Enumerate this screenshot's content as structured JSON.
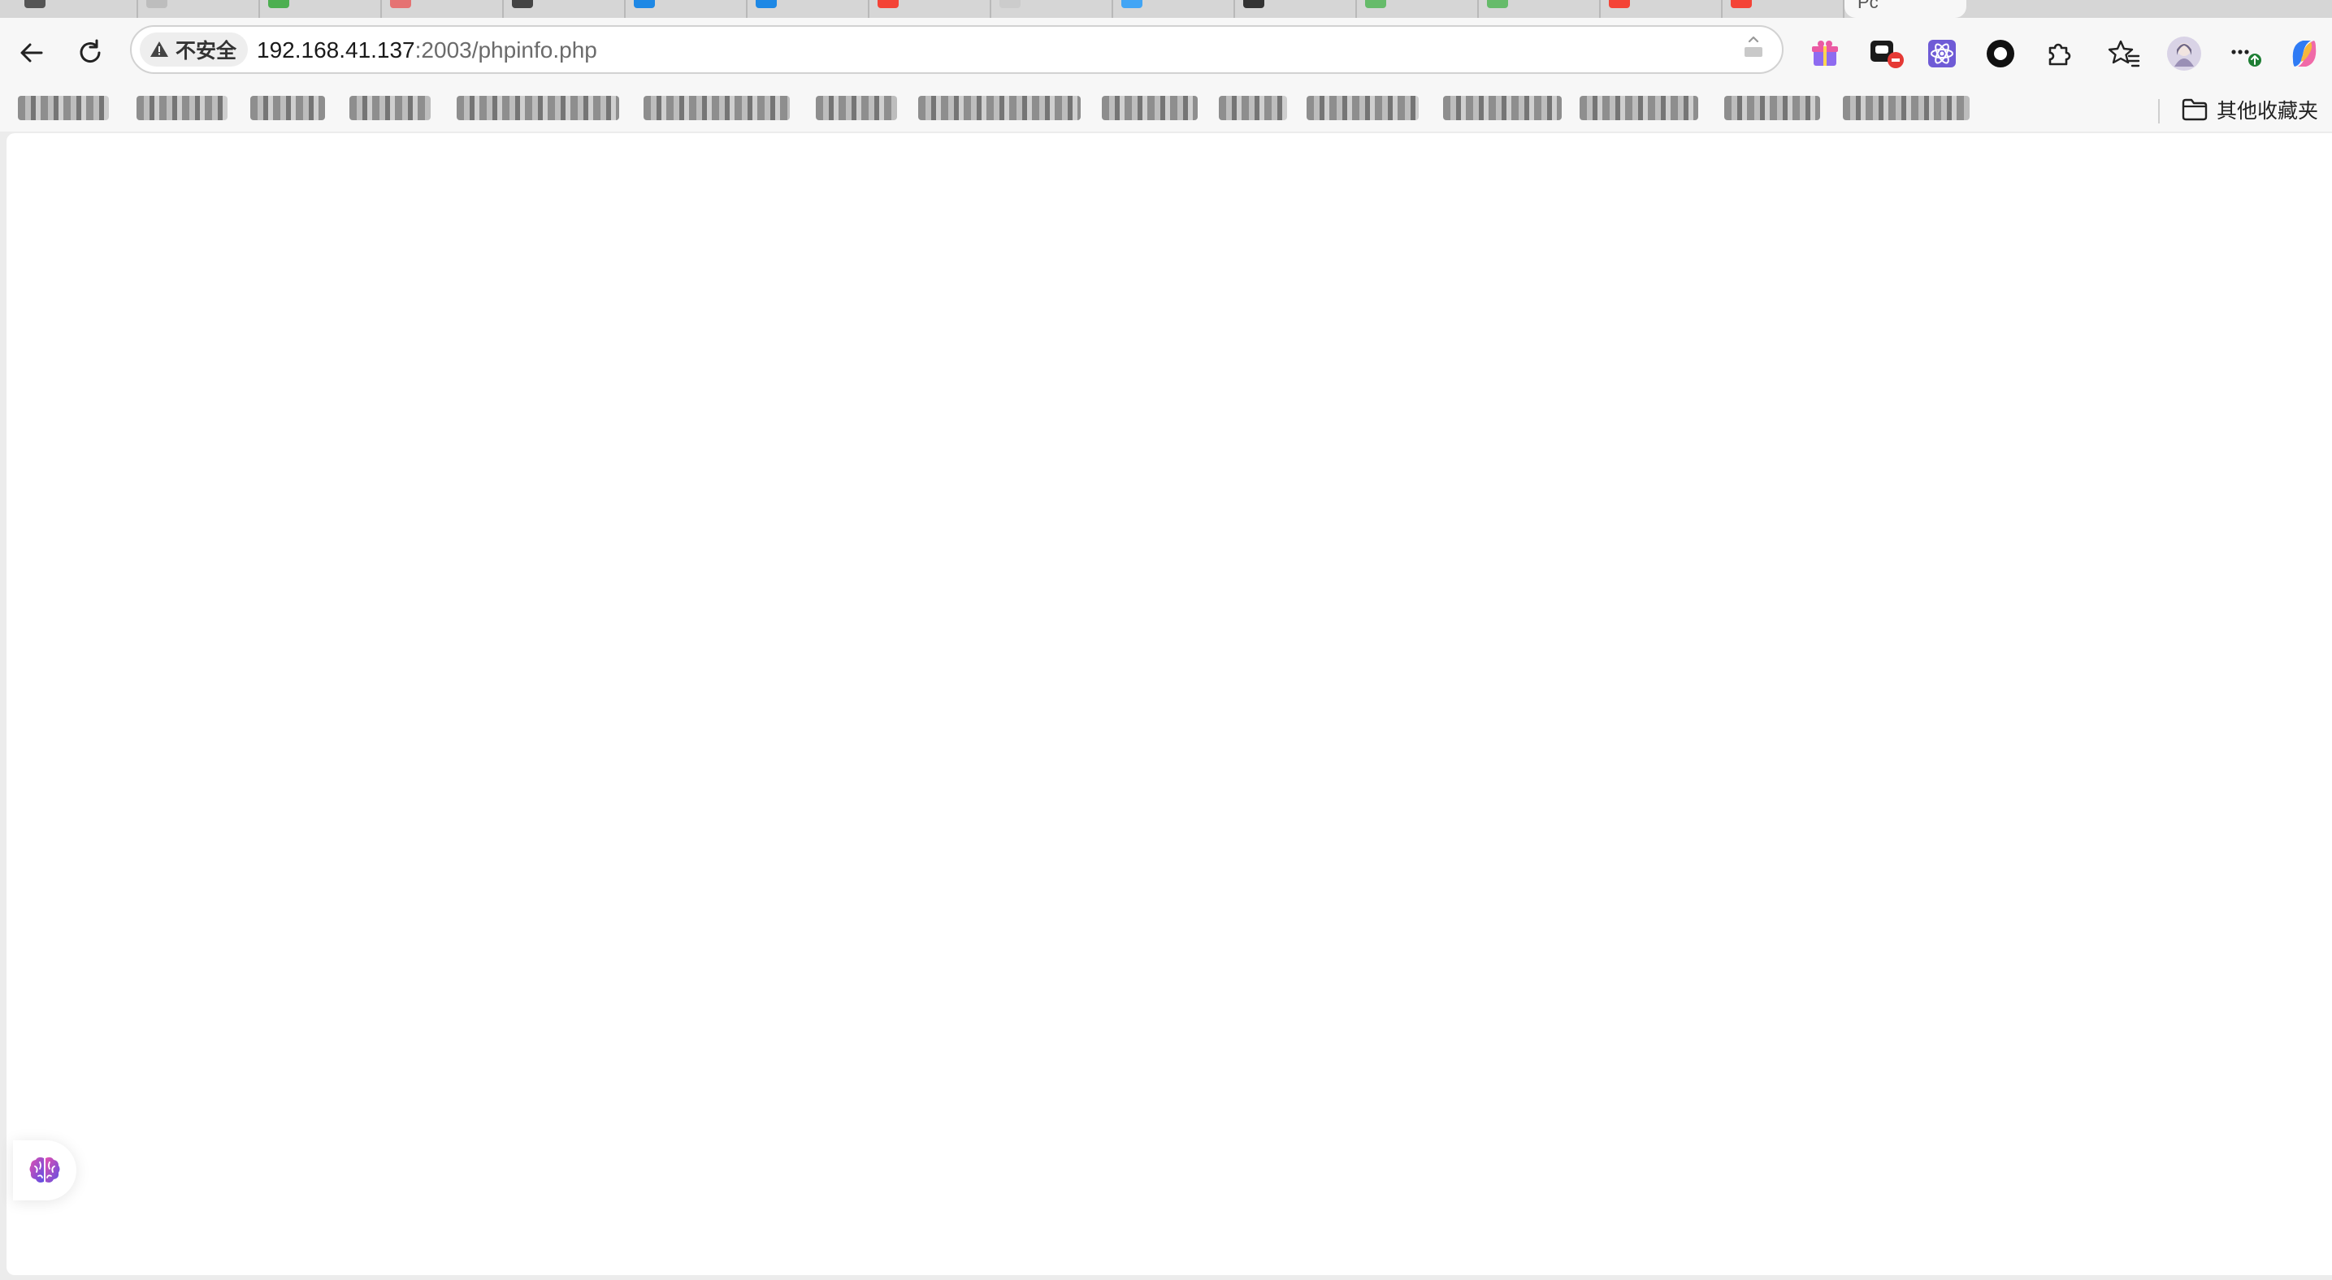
{
  "tabstrip": {
    "tab_count": 16,
    "active_tab_title": "Pc"
  },
  "toolbar": {
    "security_label": "不安全",
    "url_host": "192.168.41.137",
    "url_path": ":2003/phpinfo.php"
  },
  "bookmarks": {
    "other_folder_label": "其他收藏夹"
  },
  "colors": {
    "tab_favicons": [
      "#555555",
      "#4caf50",
      "#e57373",
      "#444444",
      "#1e88e5",
      "#1e88e5",
      "#f44336",
      "#bbbbbb",
      "#42a5f5",
      "#333333",
      "#66bb6a",
      "#66bb6a",
      "#f44336",
      "#f44336"
    ],
    "accent": "#1a73e8",
    "warning_icon": "#444444"
  },
  "icons": {
    "back": "back-arrow-icon",
    "reload": "reload-icon",
    "warning": "warning-triangle-icon",
    "extensions": [
      "gift-extension-icon",
      "game-extension-icon",
      "react-devtools-icon",
      "circle-extension-icon",
      "puzzle-extensions-icon"
    ],
    "favorites": "favorites-star-icon",
    "profile": "profile-avatar-icon",
    "more": "more-menu-icon",
    "copilot": "copilot-icon",
    "folder": "folder-icon",
    "brain": "brain-widget-icon"
  }
}
